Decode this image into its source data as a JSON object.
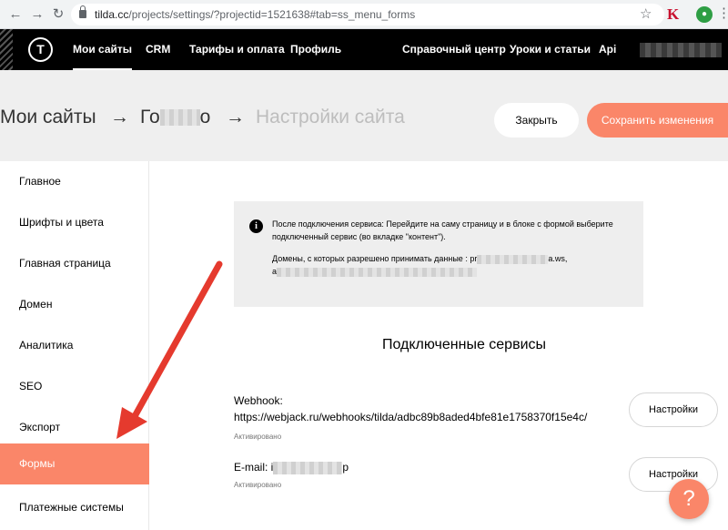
{
  "browser": {
    "url_host": "tilda.cc",
    "url_path": "/projects/settings/?projectid=1521638#tab=ss_menu_forms",
    "ext_k_label": "K"
  },
  "topbar": {
    "logo": "T",
    "nav_left": [
      "Мои сайты",
      "CRM",
      "Тарифы и оплата",
      "Профиль"
    ],
    "nav_right": [
      "Справочный центр",
      "Уроки и статьи",
      "Api"
    ]
  },
  "header": {
    "crumb_1": "Мои сайты",
    "sep": "→",
    "crumb_2_start": "Го",
    "crumb_2_end": "о",
    "crumb_3": "Настройки сайта",
    "close_label": "Закрыть",
    "save_label": "Сохранить изменения"
  },
  "sidebar": {
    "items": [
      "Главное",
      "Шрифты и цвета",
      "Главная страница",
      "Домен",
      "Аналитика",
      "SEO",
      "Экспорт",
      "Формы",
      "Платежные системы"
    ],
    "active_index": 7
  },
  "info": {
    "icon": "i",
    "line1": "После подключения сервиса: Перейдите на саму страницу и в блоке с формой выберите",
    "line2": "подключенный сервис (во вкладке \"контент\").",
    "domains_label": "Домены, с которых разрешено принимать данные : pr",
    "domains_suffix": "a.ws,",
    "domains_line2_start": "a"
  },
  "services": {
    "title": "Подключенные сервисы",
    "items": [
      {
        "name": "Webhook:",
        "detail": "https://webjack.ru/webhooks/tilda/adbc89b8aded4bfe81e1758370f15e4c/",
        "status": "Активировано",
        "button": "Настройки"
      },
      {
        "name": "E-mail: i",
        "detail_end": "p",
        "status": "Активировано",
        "button": "Настройки"
      }
    ]
  },
  "help": {
    "label": "?"
  },
  "colors": {
    "accent": "#fa8669",
    "topbar": "#000000",
    "header_bg": "#efefef",
    "info_bg": "#eeeeee",
    "annotation_arrow": "#e53a2e"
  }
}
